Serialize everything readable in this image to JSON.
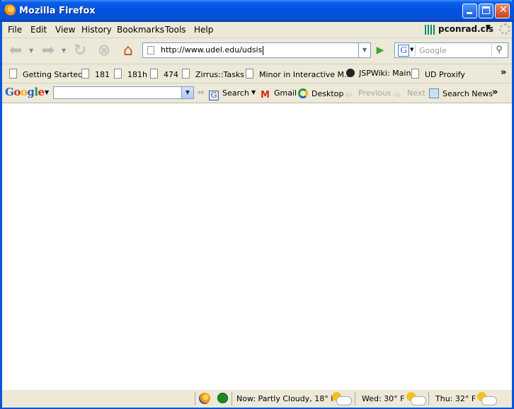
{
  "window": {
    "title": "Mozilla Firefox"
  },
  "menubar": {
    "items": [
      "File",
      "Edit",
      "View",
      "History",
      "Bookmarks",
      "Tools",
      "Help"
    ],
    "profile_name": "pconrad.cis"
  },
  "navbar": {
    "url": "http://www.udel.edu/udsis",
    "search_placeholder": "Google",
    "search_engine_letter": "G"
  },
  "bookmarks": {
    "items": [
      "Getting Started",
      "181",
      "181h",
      "474",
      "Zirrus::Tasks",
      "Minor in Interactive M...",
      "JSPWiki: Main",
      "UD Proxify"
    ],
    "overflow": "»"
  },
  "google_toolbar": {
    "logo": "Google",
    "search_label": "Search",
    "gmail_label": "Gmail",
    "desktop_label": "Desktop",
    "previous_label": "Previous",
    "next_label": "Next",
    "search_news_label": "Search News",
    "overflow": "»"
  },
  "statusbar": {
    "weather_now": "Now: Partly Cloudy, 18° F",
    "weather_wed": "Wed: 30° F",
    "weather_thu": "Thu: 32° F"
  },
  "colors": {
    "titlebar": "#0053e1",
    "chrome": "#ece9d8",
    "google_blue": "#2a5fc7",
    "google_red": "#d62d20",
    "google_yellow": "#f4b400",
    "google_green": "#1a9e3f",
    "go_green": "#3fa535"
  }
}
